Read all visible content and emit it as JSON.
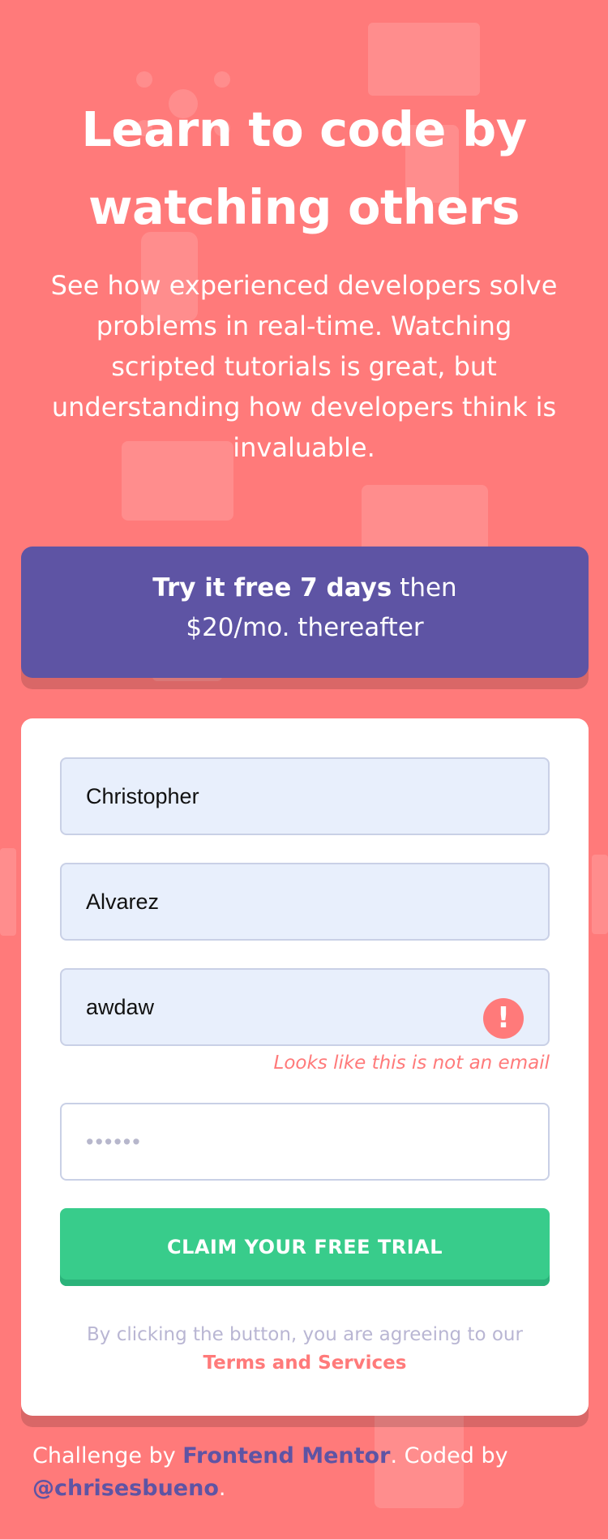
{
  "hero": {
    "title": "Learn to code by watching others",
    "description": "See how experienced developers solve problems in real-time. Watching scripted tutorials is great, but understanding how developers think is invaluable."
  },
  "promo": {
    "bold": "Try it free 7 days",
    "line1_rest": " then",
    "line2": "$20/mo. thereafter"
  },
  "form": {
    "first_name": "Christopher",
    "last_name": "Alvarez",
    "email": "awdaw",
    "email_error_icon": "exclamation-icon",
    "email_error": "Looks like this is not an email",
    "password_mask": "••••••",
    "submit_label": "CLAIM YOUR FREE TRIAL",
    "terms_prefix": "By clicking the button, you are agreeing to our ",
    "terms_link": "Terms and Services"
  },
  "footer": {
    "prefix": "Challenge by ",
    "frontend_mentor": "Frontend Mentor",
    "middle": ". Coded by ",
    "author": "@chrisesbueno",
    "suffix": "."
  },
  "colors": {
    "background": "#ff7a7a",
    "promo": "#5e54a4",
    "submit": "#38cc8b",
    "input_bg": "#e8effc",
    "error": "#ff7a7a"
  }
}
